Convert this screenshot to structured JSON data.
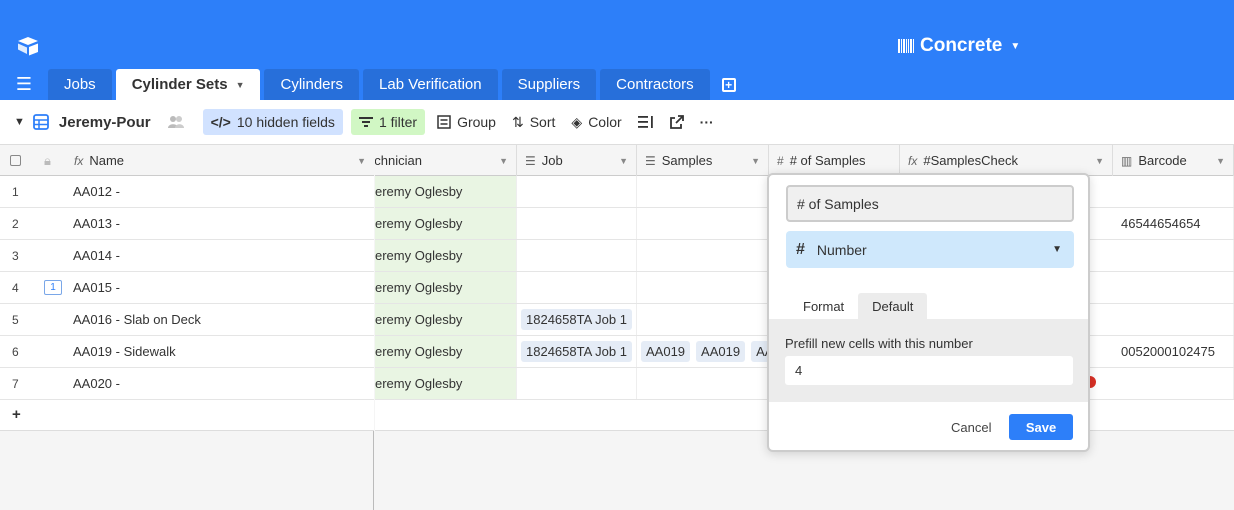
{
  "header": {
    "base_name": "Concrete",
    "accent": "#2d7ff9",
    "tabs": [
      {
        "label": "Jobs"
      },
      {
        "label": "Cylinder Sets"
      },
      {
        "label": "Cylinders"
      },
      {
        "label": "Lab Verification"
      },
      {
        "label": "Suppliers"
      },
      {
        "label": "Contractors"
      }
    ]
  },
  "toolbar": {
    "view_name": "Jeremy-Pour",
    "hidden_fields": "10 hidden fields",
    "filter": "1 filter",
    "group": "Group",
    "sort": "Sort",
    "color": "Color"
  },
  "columns": {
    "name": "Name",
    "technician": "echnician",
    "job": "Job",
    "samples": "Samples",
    "num_samples": "# of Samples",
    "samples_check": "#SamplesCheck",
    "barcode": "Barcode"
  },
  "rows": [
    {
      "num": "1",
      "name": "AA012 -",
      "tech": "eremy Oglesby",
      "job": "",
      "samples": [],
      "barcode": ""
    },
    {
      "num": "2",
      "name": "AA013 -",
      "tech": "eremy Oglesby",
      "job": "",
      "samples": [],
      "barcode": "46544654654"
    },
    {
      "num": "3",
      "name": "AA014 -",
      "tech": "eremy Oglesby",
      "job": "",
      "samples": [],
      "barcode": ""
    },
    {
      "num": "4",
      "name": "AA015 -",
      "tech": "eremy Oglesby",
      "job": "",
      "samples": [],
      "barcode": "",
      "comments": "1"
    },
    {
      "num": "5",
      "name": "AA016 - Slab on Deck",
      "tech": "eremy Oglesby",
      "job": "1824658TA Job 1",
      "samples": [],
      "barcode": ""
    },
    {
      "num": "6",
      "name": "AA019 - Sidewalk",
      "tech": "eremy Oglesby",
      "job": "1824658TA Job 1",
      "samples": [
        "AA019",
        "AA019",
        "AA"
      ],
      "barcode": "0052000102475"
    },
    {
      "num": "7",
      "name": "AA020 -",
      "tech": "eremy Oglesby",
      "job": "",
      "samples": [],
      "barcode": ""
    }
  ],
  "add_row": "+",
  "popover": {
    "field_name": "# of Samples",
    "field_type": "Number",
    "tab_format": "Format",
    "tab_default": "Default",
    "prefill_label": "Prefill new cells with this number",
    "prefill_value": "4",
    "cancel": "Cancel",
    "save": "Save"
  }
}
